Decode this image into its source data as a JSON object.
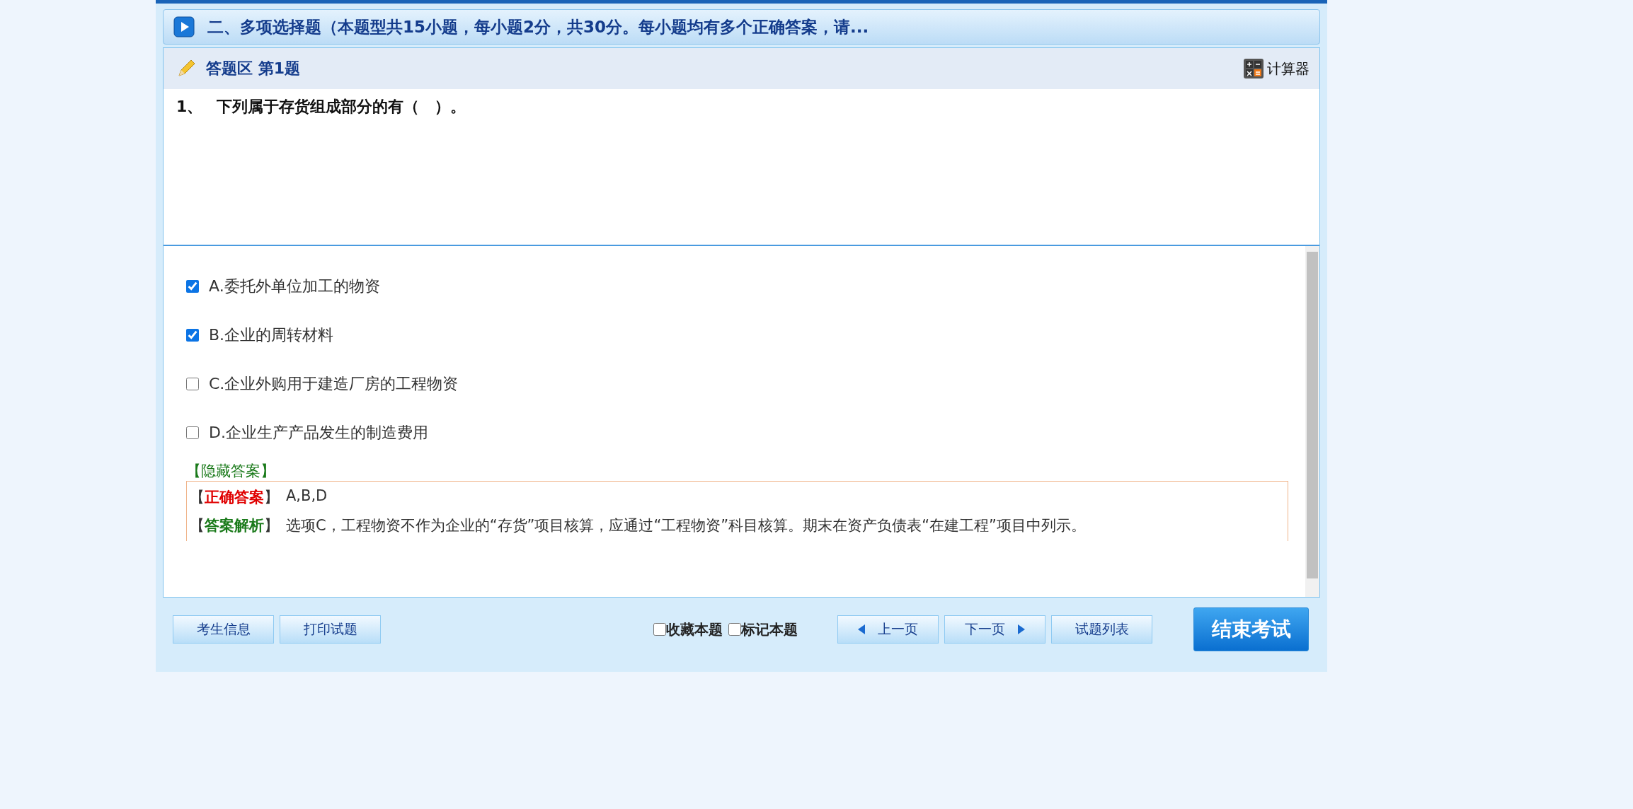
{
  "section_header": {
    "title": "二、多项选择题（本题型共15小题，每小题2分，共30分。每小题均有多个正确答案，请..."
  },
  "answer_area": {
    "title": "答题区 第1题",
    "calculator": "计算器"
  },
  "question": {
    "number": "1、",
    "text": "下列属于存货组成部分的有（　）。"
  },
  "options": [
    {
      "label": "A.委托外单位加工的物资",
      "checked": true
    },
    {
      "label": "B.企业的周转材料",
      "checked": true
    },
    {
      "label": "C.企业外购用于建造厂房的工程物资",
      "checked": false
    },
    {
      "label": "D.企业生产产品发生的制造费用",
      "checked": false
    }
  ],
  "hide_answer": "【隐藏答案】",
  "answer": {
    "correct_label": "【**正确答案**】",
    "correct_value": "A,B,D",
    "analysis_label": "【**答案解析**】",
    "analysis_text": "选项C，工程物资不作为企业的“存货”项目核算，应通过“工程物资”科目核算。期末在资产负债表“在建工程”项目中列示。"
  },
  "left_buttons": [
    "考生信息",
    "打印试题"
  ],
  "flags": [
    {
      "label": "收藏本题",
      "checked": false
    },
    {
      "label": "标记本题",
      "checked": false
    }
  ],
  "nav_buttons": [
    {
      "kind": "prev",
      "label": "上一页"
    },
    {
      "kind": "next",
      "label": "下一页"
    },
    {
      "kind": "list",
      "label": "试题列表"
    }
  ],
  "finish_button": "结束考试"
}
